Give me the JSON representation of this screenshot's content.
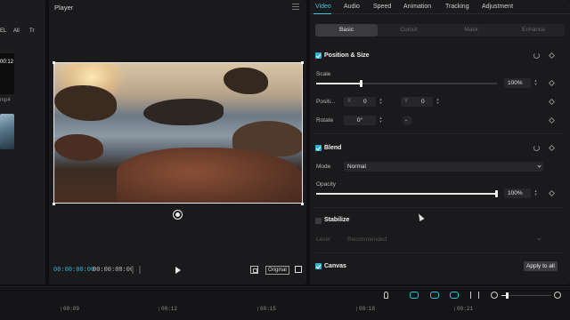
{
  "media_panel": {
    "filter_el": "EL",
    "filter_all": "All",
    "sort_label": "Tr",
    "thumb1_duration": "00:12",
    "thumb1_caption": "mp4"
  },
  "player": {
    "title": "Player",
    "current_time": "00:00:00:00",
    "total_time": "00:00:08:00",
    "original_label": "Original"
  },
  "properties": {
    "tabs": [
      "Video",
      "Audio",
      "Speed",
      "Animation",
      "Tracking",
      "Adjustment"
    ],
    "active_tab": "Video",
    "subtabs": [
      "Basic",
      "Cutout",
      "Mask",
      "Enhance"
    ],
    "active_subtab": "Basic",
    "position_size": {
      "title": "Position & Size",
      "scale_label": "Scale",
      "scale_value": "100%",
      "scale_level": 0.25,
      "position_label": "Positi...",
      "x_label": "X",
      "x_value": "0",
      "y_label": "Y",
      "y_value": "0",
      "rotate_label": "Rotate",
      "rotate_value": "0°",
      "rotate_extra": "-"
    },
    "blend": {
      "title": "Blend",
      "mode_label": "Mode",
      "mode_value": "Normal",
      "opacity_label": "Opacity",
      "opacity_value": "100%",
      "opacity_level": 1.0
    },
    "stabilize": {
      "title": "Stabilize",
      "level_label": "Level",
      "level_value": "Recommended"
    },
    "canvas": {
      "title": "Canvas",
      "apply_label": "Apply to all"
    }
  },
  "timeline": {
    "ruler": [
      "00:09",
      "00:12",
      "00:15",
      "00:18",
      "00:21"
    ],
    "zoom_level": 0.12
  },
  "colors": {
    "accent": "#3ec8e0",
    "checkbox": "#2ab7d4",
    "panel": "#1a1a1c",
    "background": "#101012"
  }
}
